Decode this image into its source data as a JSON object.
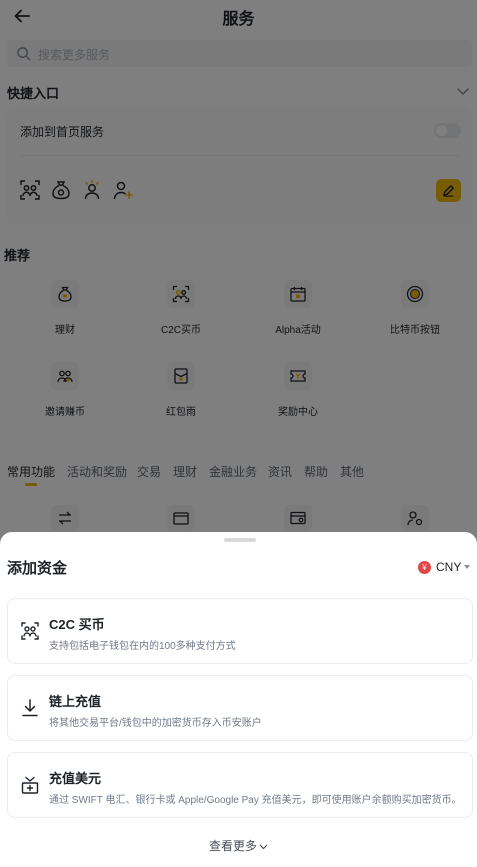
{
  "header": {
    "title": "服务"
  },
  "search": {
    "placeholder": "搜索更多服务"
  },
  "quick": {
    "section_title": "快捷入口",
    "add_label": "添加到首页服务"
  },
  "recommend": {
    "section_title": "推荐",
    "items": [
      {
        "label": "理财",
        "icon": "money-bag-icon"
      },
      {
        "label": "C2C买币",
        "icon": "c2c-users-icon"
      },
      {
        "label": "Alpha活动",
        "icon": "calendar-icon"
      },
      {
        "label": "比特币按钮",
        "icon": "bitcoin-button-icon"
      },
      {
        "label": "邀请赚币",
        "icon": "invite-users-icon"
      },
      {
        "label": "红包雨",
        "icon": "red-packet-icon"
      },
      {
        "label": "奖励中心",
        "icon": "ticket-icon"
      }
    ]
  },
  "tabs": [
    "常用功能",
    "活动和奖励",
    "交易",
    "理财",
    "金融业务",
    "资讯",
    "帮助",
    "其他"
  ],
  "sheet": {
    "title": "添加资金",
    "currency": {
      "code": "CNY",
      "symbol": "¥"
    },
    "options": [
      {
        "title": "C2C 买币",
        "desc": "支持包括电子钱包在内的100多种支付方式",
        "icon": "c2c-users-icon"
      },
      {
        "title": "链上充值",
        "desc": "将其他交易平台/钱包中的加密货币存入币安账户",
        "icon": "download-icon"
      },
      {
        "title": "充值美元",
        "desc": "通过 SWIFT 电汇、银行卡或 Apple/Google Pay 充值美元，即可使用账户余额购买加密货币。",
        "icon": "deposit-cash-icon"
      }
    ],
    "more_label": "查看更多"
  },
  "colors": {
    "accent": "#f0b90b",
    "text": "#1e2329",
    "muted": "#707a8a"
  }
}
